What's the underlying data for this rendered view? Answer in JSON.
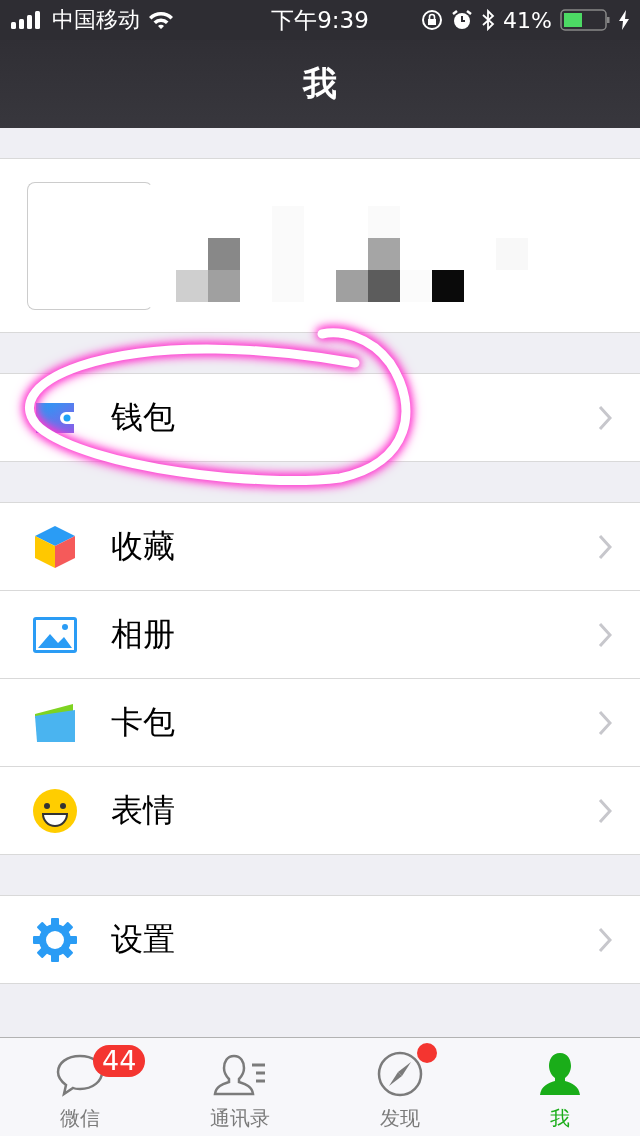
{
  "status_bar": {
    "carrier": "中国移动",
    "time": "下午9:39",
    "battery": "41%"
  },
  "nav": {
    "title": "我"
  },
  "profile": {
    "name_hidden": true
  },
  "groups": [
    {
      "items": [
        {
          "label": "钱包",
          "kind": "wallet"
        }
      ]
    },
    {
      "items": [
        {
          "label": "收藏",
          "kind": "favorites"
        },
        {
          "label": "相册",
          "kind": "album"
        },
        {
          "label": "卡包",
          "kind": "cards"
        },
        {
          "label": "表情",
          "kind": "stickers"
        }
      ]
    },
    {
      "items": [
        {
          "label": "设置",
          "kind": "settings"
        }
      ]
    }
  ],
  "annotation": {
    "kind": "circle"
  },
  "tabs": [
    {
      "label": "微信",
      "kind": "chats",
      "selected": false,
      "badge": "44"
    },
    {
      "label": "通讯录",
      "kind": "contacts",
      "selected": false
    },
    {
      "label": "发现",
      "kind": "discover",
      "selected": false,
      "dot": true
    },
    {
      "label": "我",
      "kind": "me",
      "selected": true
    }
  ]
}
